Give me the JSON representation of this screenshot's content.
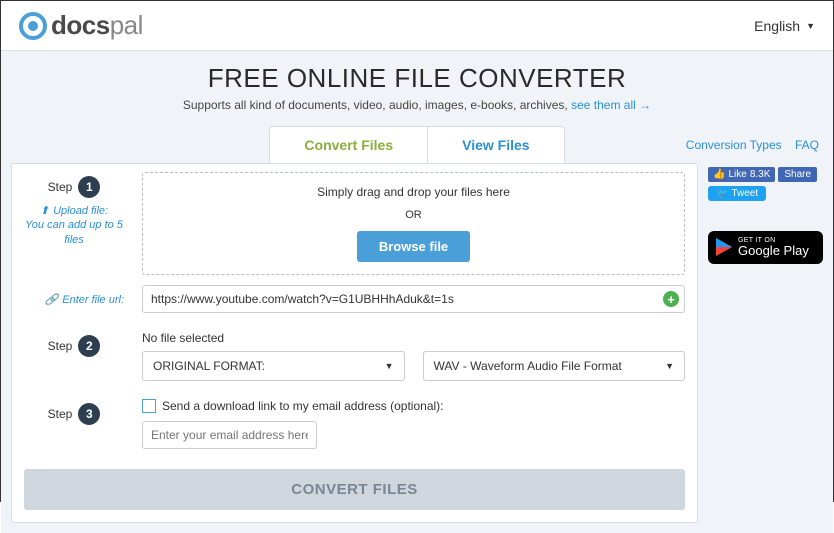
{
  "header": {
    "brand_docs": "docs",
    "brand_pal": "pal",
    "language": "English"
  },
  "hero": {
    "title": "FREE ONLINE FILE CONVERTER",
    "subtitle_prefix": "Supports all kind of documents, video, audio, images, e-books, archives, ",
    "subtitle_link": "see them all →"
  },
  "tabs": {
    "convert": "Convert Files",
    "view": "View Files"
  },
  "right_links": {
    "types": "Conversion Types",
    "faq": "FAQ"
  },
  "step_label": "Step",
  "step1": {
    "num": "1",
    "upload_label": "Upload file:",
    "upload_hint": "You can add up to 5 files",
    "drop_text": "Simply drag and drop your files here",
    "or": "OR",
    "browse": "Browse file",
    "url_label": "Enter file url:",
    "url_value": "https://www.youtube.com/watch?v=G1UBHHhAduk&t=1s"
  },
  "step2": {
    "num": "2",
    "nofile": "No file selected",
    "format_from": "ORIGINAL FORMAT:",
    "format_to": "WAV - Waveform Audio File Format"
  },
  "step3": {
    "num": "3",
    "checkbox_label": "Send a download link to my email address (optional):",
    "email_placeholder": "Enter your email address here"
  },
  "convert_button": "CONVERT FILES",
  "social": {
    "like": "Like",
    "like_count": "8.3K",
    "share": "Share",
    "tweet": "Tweet"
  },
  "gplay": {
    "small": "GET IT ON",
    "large": "Google Play"
  }
}
